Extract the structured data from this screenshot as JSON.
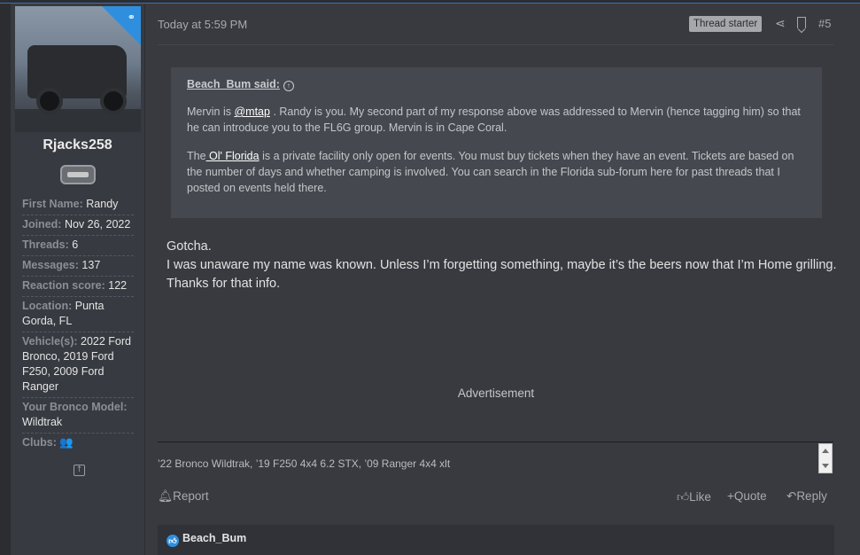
{
  "user": {
    "name": "Rjacks258",
    "stats": [
      {
        "label": "First Name:",
        "value": "Randy"
      },
      {
        "label": "Joined:",
        "value": "Nov 26, 2022"
      },
      {
        "label": "Threads:",
        "value": "6"
      },
      {
        "label": "Messages:",
        "value": "137"
      },
      {
        "label": "Reaction score:",
        "value": "122"
      },
      {
        "label": "Location:",
        "value": "Punta Gorda, FL"
      },
      {
        "label": "Vehicle(s):",
        "value": "2022 Ford Bronco, 2019 Ford F250, 2009 Ford Ranger"
      },
      {
        "label": "Your Bronco Model:",
        "value": "Wildtrak"
      },
      {
        "label": "Clubs:",
        "value": "👥"
      }
    ]
  },
  "post": {
    "date": "Today at 5:59 PM",
    "thread_starter": "Thread starter",
    "number": "#5",
    "quote": {
      "author": "Beach_Bum said:",
      "p1_a": "Mervin is ",
      "p1_mention": "@mtap",
      "p1_b": " . Randy is you. My second part of my response above was addressed to Mervin (hence tagging him) so that he can introduce you to the FL6G group. Mervin is in Cape Coral.",
      "p2_a": "The",
      "p2_link": " Ol' Florida",
      "p2_b": " is a private facility only open for events. You must buy tickets when they have an event. Tickets are based on the number of days and whether camping is involved. You can search in the Florida sub-forum here for past threads that I posted on events held there."
    },
    "body": [
      "Gotcha.",
      "I was unaware my name was known. Unless I’m forgetting something, maybe it’s the beers now that I’m Home grilling.",
      "Thanks for that info."
    ],
    "advertisement": "Advertisement",
    "signature": "’22 Bronco Wildtrak, ’19 F250 4x4 6.2 STX, ’09 Ranger 4x4 xlt",
    "actions": {
      "report": "Report",
      "like": "Like",
      "quote": "Quote",
      "reply": "Reply"
    },
    "reaction_user": "Beach_Bum"
  }
}
